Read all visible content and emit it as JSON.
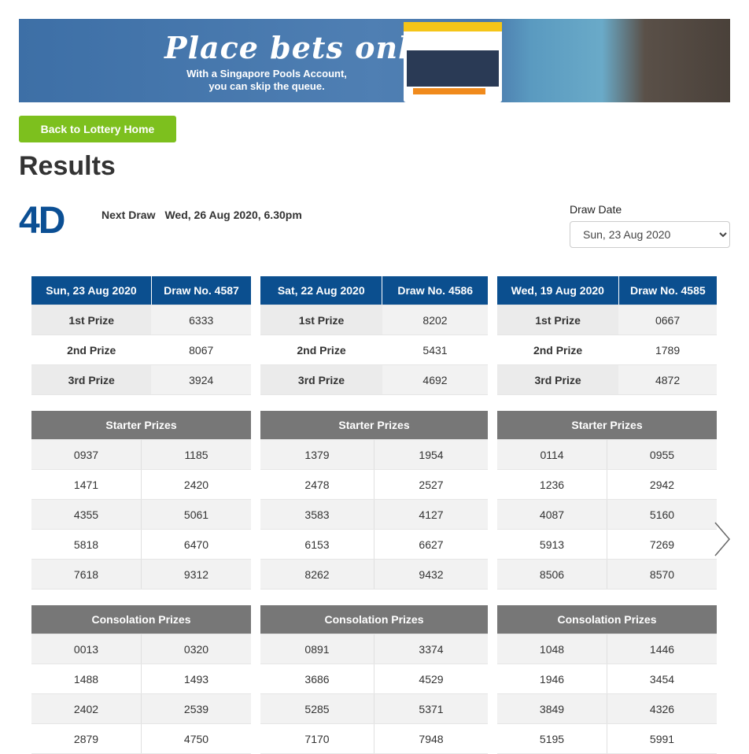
{
  "banner": {
    "title": "Place bets online",
    "subtitle_line1": "With a Singapore Pools Account,",
    "subtitle_line2": "you can skip the queue."
  },
  "back_button": "Back to Lottery Home",
  "page_title": "Results",
  "logo": "4D",
  "next_draw": {
    "label": "Next Draw",
    "value": "Wed, 26 Aug 2020, 6.30pm"
  },
  "draw_date": {
    "label": "Draw Date",
    "selected": "Sun, 23 Aug 2020"
  },
  "section_labels": {
    "starter": "Starter Prizes",
    "consolation": "Consolation Prizes"
  },
  "prize_labels": [
    "1st Prize",
    "2nd Prize",
    "3rd Prize"
  ],
  "draws": [
    {
      "date": "Sun, 23 Aug 2020",
      "draw_no": "Draw No. 4587",
      "top": [
        "6333",
        "8067",
        "3924"
      ],
      "starter": [
        [
          "0937",
          "1185"
        ],
        [
          "1471",
          "2420"
        ],
        [
          "4355",
          "5061"
        ],
        [
          "5818",
          "6470"
        ],
        [
          "7618",
          "9312"
        ]
      ],
      "consolation": [
        [
          "0013",
          "0320"
        ],
        [
          "1488",
          "1493"
        ],
        [
          "2402",
          "2539"
        ],
        [
          "2879",
          "4750"
        ]
      ]
    },
    {
      "date": "Sat, 22 Aug 2020",
      "draw_no": "Draw No. 4586",
      "top": [
        "8202",
        "5431",
        "4692"
      ],
      "starter": [
        [
          "1379",
          "1954"
        ],
        [
          "2478",
          "2527"
        ],
        [
          "3583",
          "4127"
        ],
        [
          "6153",
          "6627"
        ],
        [
          "8262",
          "9432"
        ]
      ],
      "consolation": [
        [
          "0891",
          "3374"
        ],
        [
          "3686",
          "4529"
        ],
        [
          "5285",
          "5371"
        ],
        [
          "7170",
          "7948"
        ]
      ]
    },
    {
      "date": "Wed, 19 Aug 2020",
      "draw_no": "Draw No. 4585",
      "top": [
        "0667",
        "1789",
        "4872"
      ],
      "starter": [
        [
          "0114",
          "0955"
        ],
        [
          "1236",
          "2942"
        ],
        [
          "4087",
          "5160"
        ],
        [
          "5913",
          "7269"
        ],
        [
          "8506",
          "8570"
        ]
      ],
      "consolation": [
        [
          "1048",
          "1446"
        ],
        [
          "1946",
          "3454"
        ],
        [
          "3849",
          "4326"
        ],
        [
          "5195",
          "5991"
        ]
      ]
    }
  ],
  "colors": {
    "header_blue": "#0b4f8f",
    "section_gray": "#777777",
    "button_green": "#7dc01e"
  }
}
